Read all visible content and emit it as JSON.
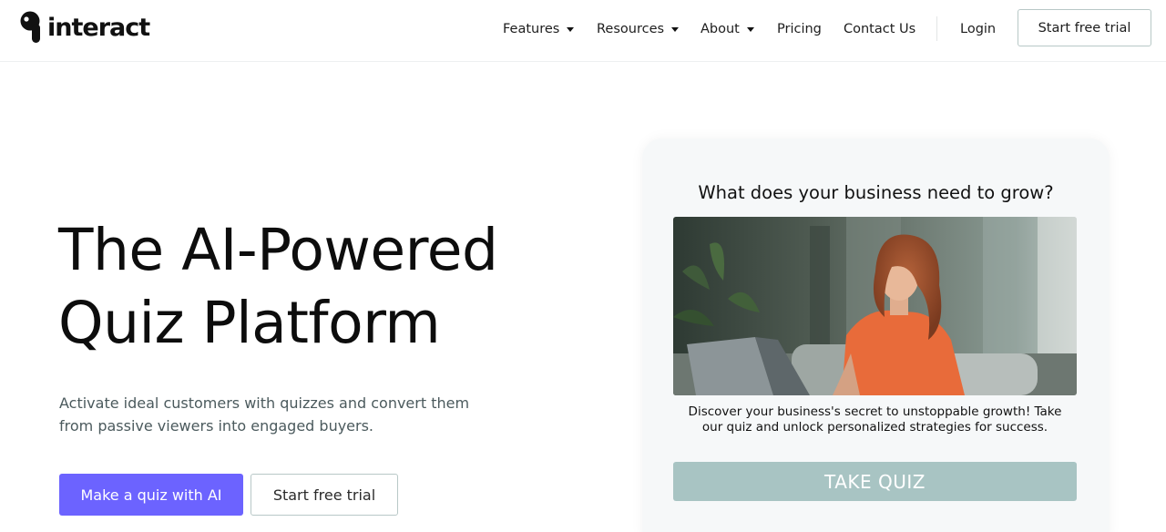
{
  "header": {
    "logo_text": "interact",
    "nav": [
      {
        "label": "Features",
        "has_dropdown": true
      },
      {
        "label": "Resources",
        "has_dropdown": true
      },
      {
        "label": "About",
        "has_dropdown": true
      },
      {
        "label": "Pricing",
        "has_dropdown": false
      },
      {
        "label": "Contact Us",
        "has_dropdown": false
      }
    ],
    "login_label": "Login",
    "cta_label": "Start free trial"
  },
  "hero": {
    "title_line1": "The AI-Powered",
    "title_line2": "Quiz Platform",
    "subtitle": "Activate ideal customers with quizzes and convert them from passive viewers into engaged buyers.",
    "primary_button": "Make a quiz with AI",
    "secondary_button": "Start free trial"
  },
  "quiz_card": {
    "question": "What does your business need to grow?",
    "image_icon": "woman-with-laptop-photo",
    "description": "Discover your business's secret to unstoppable growth! Take our quiz and unlock personalized strategies for success.",
    "button_label": "TAKE QUIZ"
  },
  "colors": {
    "primary": "#6c63ff",
    "quiz_button": "#a8c4c3",
    "border_accent": "#b8c8c7",
    "card_bg": "#f6f8f9"
  }
}
